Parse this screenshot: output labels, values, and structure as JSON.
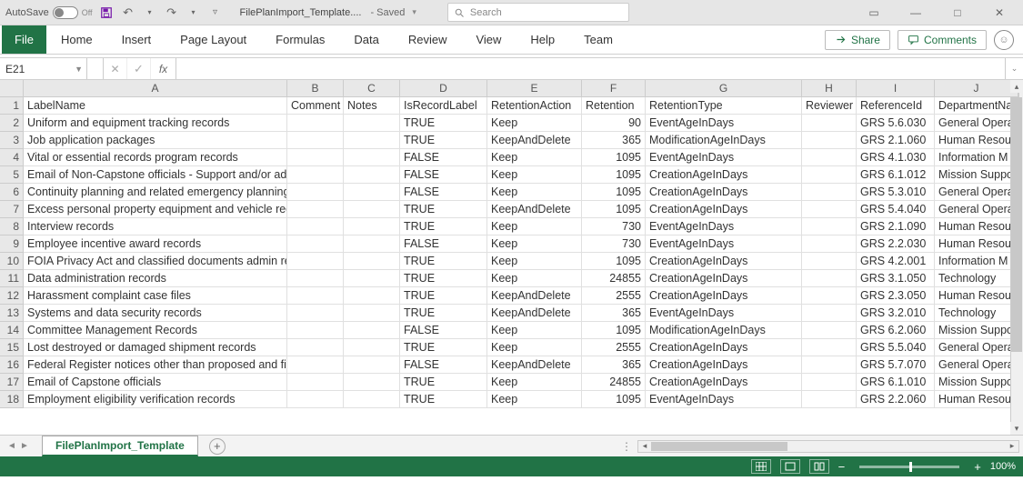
{
  "titlebar": {
    "autosave_label": "AutoSave",
    "autosave_state": "Off",
    "filename": "FilePlanImport_Template....",
    "save_state": "Saved",
    "search_placeholder": "Search"
  },
  "ribbon": {
    "tabs": [
      "File",
      "Home",
      "Insert",
      "Page Layout",
      "Formulas",
      "Data",
      "Review",
      "View",
      "Help",
      "Team"
    ],
    "share": "Share",
    "comments": "Comments"
  },
  "namebox": "E21",
  "fx_label": "fx",
  "columns": [
    "A",
    "B",
    "C",
    "D",
    "E",
    "F",
    "G",
    "H",
    "I",
    "J"
  ],
  "headers": {
    "A": "LabelName",
    "B": "Comment",
    "C": "Notes",
    "D": "IsRecordLabel",
    "E": "RetentionAction",
    "F": "Retention",
    "G": "RetentionType",
    "H": "Reviewer",
    "I": "ReferenceId",
    "J": "DepartmentNa"
  },
  "rows": [
    {
      "n": 2,
      "A": "Uniform and equipment tracking records",
      "B": "",
      "C": "",
      "D": "TRUE",
      "E": "Keep",
      "F": "90",
      "G": "EventAgeInDays",
      "H": "",
      "I": "GRS 5.6.030",
      "J": "General Opera"
    },
    {
      "n": 3,
      "A": "Job application packages",
      "B": "",
      "C": "",
      "D": "TRUE",
      "E": "KeepAndDelete",
      "F": "365",
      "G": "ModificationAgeInDays",
      "H": "",
      "I": "GRS 2.1.060",
      "J": "Human Resour"
    },
    {
      "n": 4,
      "A": "Vital or essential records program records",
      "B": "",
      "C": "",
      "D": "FALSE",
      "E": "Keep",
      "F": "1095",
      "G": "EventAgeInDays",
      "H": "",
      "I": "GRS 4.1.030",
      "J": "Information M"
    },
    {
      "n": 5,
      "A": "Email of Non-Capstone officials - Support and/or admin positions",
      "B": "",
      "C": "",
      "D": "FALSE",
      "E": "Keep",
      "F": "1095",
      "G": "CreationAgeInDays",
      "H": "",
      "I": "GRS 6.1.012",
      "J": "Mission Suppo"
    },
    {
      "n": 6,
      "A": "Continuity planning and related emergency planning files",
      "B": "",
      "C": "",
      "D": "FALSE",
      "E": "Keep",
      "F": "1095",
      "G": "CreationAgeInDays",
      "H": "",
      "I": "GRS 5.3.010",
      "J": "General Opera"
    },
    {
      "n": 7,
      "A": "Excess personal property equipment and vehicle records",
      "B": "",
      "C": "",
      "D": "TRUE",
      "E": "KeepAndDelete",
      "F": "1095",
      "G": "CreationAgeInDays",
      "H": "",
      "I": "GRS 5.4.040",
      "J": "General Opera"
    },
    {
      "n": 8,
      "A": "Interview records",
      "B": "",
      "C": "",
      "D": "TRUE",
      "E": "Keep",
      "F": "730",
      "G": "EventAgeInDays",
      "H": "",
      "I": "GRS 2.1.090",
      "J": "Human Resour"
    },
    {
      "n": 9,
      "A": "Employee incentive award records",
      "B": "",
      "C": "",
      "D": "FALSE",
      "E": "Keep",
      "F": "730",
      "G": "EventAgeInDays",
      "H": "",
      "I": "GRS 2.2.030",
      "J": "Human Resour"
    },
    {
      "n": 10,
      "A": "FOIA Privacy Act and classified documents admin records",
      "B": "",
      "C": "",
      "D": "TRUE",
      "E": "Keep",
      "F": "1095",
      "G": "CreationAgeInDays",
      "H": "",
      "I": "GRS 4.2.001",
      "J": "Information M"
    },
    {
      "n": 11,
      "A": "Data administration records",
      "B": "",
      "C": "",
      "D": "TRUE",
      "E": "Keep",
      "F": "24855",
      "G": "CreationAgeInDays",
      "H": "",
      "I": "GRS 3.1.050",
      "J": "Technology"
    },
    {
      "n": 12,
      "A": "Harassment complaint case files",
      "B": "",
      "C": "",
      "D": "TRUE",
      "E": "KeepAndDelete",
      "F": "2555",
      "G": "CreationAgeInDays",
      "H": "",
      "I": "GRS 2.3.050",
      "J": "Human Resour"
    },
    {
      "n": 13,
      "A": "Systems and data security records",
      "B": "",
      "C": "",
      "D": "TRUE",
      "E": "KeepAndDelete",
      "F": "365",
      "G": "EventAgeInDays",
      "H": "",
      "I": "GRS 3.2.010",
      "J": "Technology"
    },
    {
      "n": 14,
      "A": "Committee Management Records",
      "B": "",
      "C": "",
      "D": "FALSE",
      "E": "Keep",
      "F": "1095",
      "G": "ModificationAgeInDays",
      "H": "",
      "I": "GRS 6.2.060",
      "J": "Mission Suppo"
    },
    {
      "n": 15,
      "A": "Lost destroyed or damaged shipment records",
      "B": "",
      "C": "",
      "D": "TRUE",
      "E": "Keep",
      "F": "2555",
      "G": "CreationAgeInDays",
      "H": "",
      "I": "GRS 5.5.040",
      "J": "General Opera"
    },
    {
      "n": 16,
      "A": "Federal Register notices other than proposed and final rules",
      "B": "",
      "C": "",
      "D": "FALSE",
      "E": "KeepAndDelete",
      "F": "365",
      "G": "CreationAgeInDays",
      "H": "",
      "I": "GRS 5.7.070",
      "J": "General Opera"
    },
    {
      "n": 17,
      "A": "Email of Capstone officials",
      "B": "",
      "C": "",
      "D": "TRUE",
      "E": "Keep",
      "F": "24855",
      "G": "CreationAgeInDays",
      "H": "",
      "I": "GRS 6.1.010",
      "J": "Mission Suppo"
    },
    {
      "n": 18,
      "A": "Employment eligibility verification records",
      "B": "",
      "C": "",
      "D": "TRUE",
      "E": "Keep",
      "F": "1095",
      "G": "EventAgeInDays",
      "H": "",
      "I": "GRS 2.2.060",
      "J": "Human Resour"
    }
  ],
  "sheet_tab": "FilePlanImport_Template",
  "zoom": "100%"
}
